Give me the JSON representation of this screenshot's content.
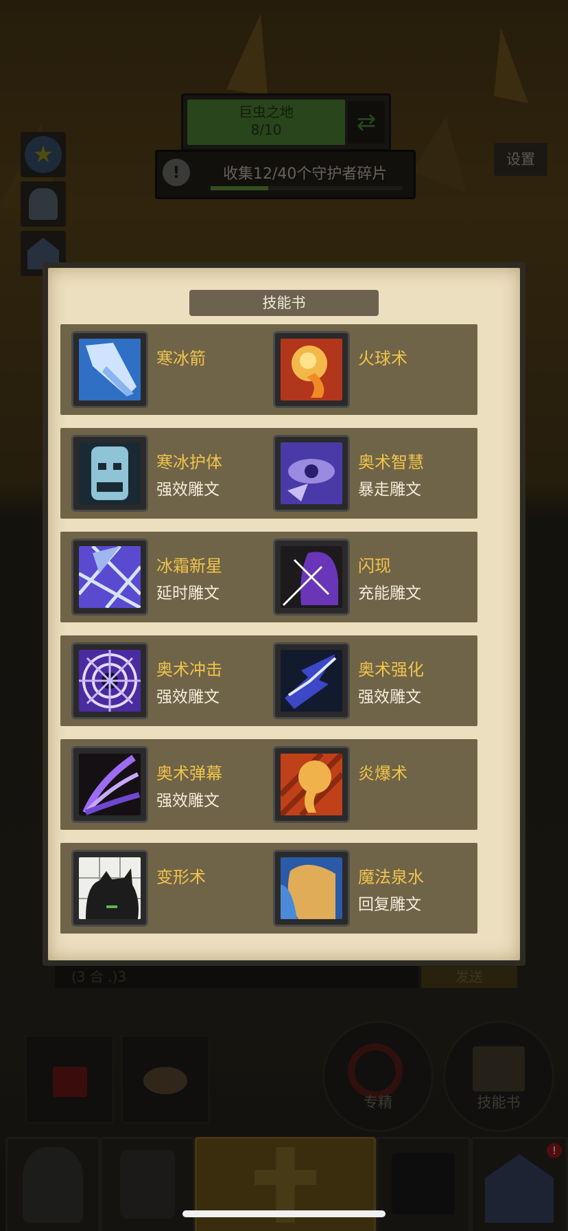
{
  "region": {
    "name": "巨虫之地",
    "progress": "8/10"
  },
  "quest": {
    "text": "收集12/40个守护者碎片",
    "progress_fraction": 0.3
  },
  "settings_label": "设置",
  "chat": {
    "input_text": "(3 合 .)3",
    "send_label": "发送"
  },
  "bottom_buttons": {
    "mastery_label": "专精",
    "skillbook_label": "技能书"
  },
  "skill_book": {
    "title": "技能书",
    "skills": [
      {
        "name": "寒冰箭",
        "rune": "",
        "icon": "frost-bolt-icon"
      },
      {
        "name": "火球术",
        "rune": "",
        "icon": "fireball-icon"
      },
      {
        "name": "寒冰护体",
        "rune": "强效雕文",
        "icon": "ice-barrier-icon"
      },
      {
        "name": "奥术智慧",
        "rune": "暴走雕文",
        "icon": "arcane-intellect-icon"
      },
      {
        "name": "冰霜新星",
        "rune": "延时雕文",
        "icon": "frost-nova-icon"
      },
      {
        "name": "闪现",
        "rune": "充能雕文",
        "icon": "blink-icon"
      },
      {
        "name": "奥术冲击",
        "rune": "强效雕文",
        "icon": "arcane-blast-icon"
      },
      {
        "name": "奥术强化",
        "rune": "强效雕文",
        "icon": "arcane-power-icon"
      },
      {
        "name": "奥术弹幕",
        "rune": "强效雕文",
        "icon": "arcane-barrage-icon"
      },
      {
        "name": "炎爆术",
        "rune": "",
        "icon": "pyroblast-icon"
      },
      {
        "name": "变形术",
        "rune": "",
        "icon": "polymorph-icon"
      },
      {
        "name": "魔法泉水",
        "rune": "回复雕文",
        "icon": "mana-fountain-icon"
      }
    ]
  },
  "colors": {
    "skill_name": "#f0c44c",
    "card_bg": "#706448",
    "paper": "#ecdfbf"
  }
}
